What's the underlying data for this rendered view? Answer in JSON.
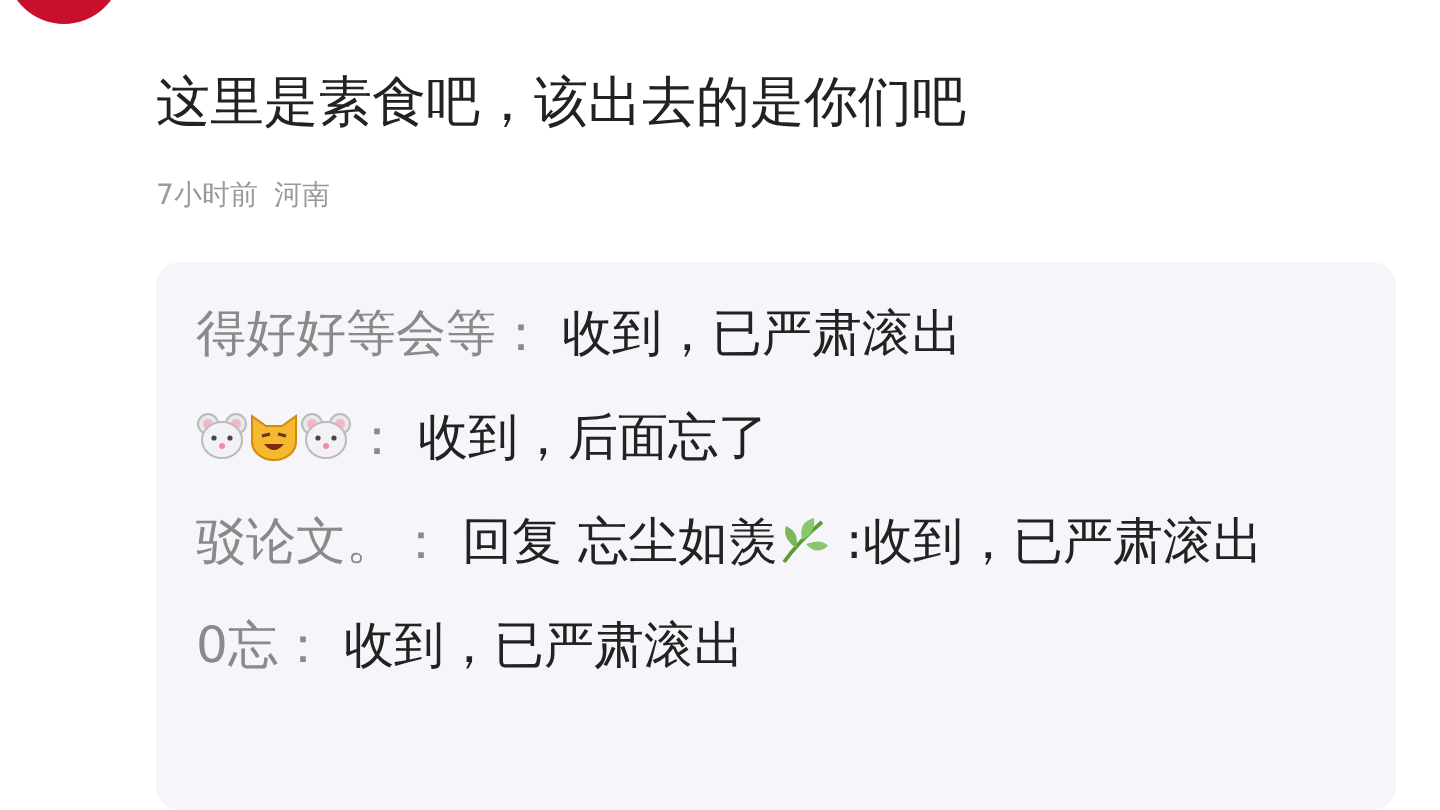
{
  "comment": {
    "text": "这里是素食吧，该出去的是你们吧",
    "time": "7小时前",
    "location": "河南"
  },
  "replies": [
    {
      "name": [
        {
          "kind": "text",
          "text": "得好好等会等："
        }
      ],
      "content": [
        {
          "kind": "text",
          "text": "收到，已严肃滚出"
        }
      ]
    },
    {
      "name": [
        {
          "kind": "mouse"
        },
        {
          "kind": "cat"
        },
        {
          "kind": "mouse"
        },
        {
          "kind": "text",
          "text": "："
        }
      ],
      "content": [
        {
          "kind": "text",
          "text": "收到，后面忘了"
        }
      ]
    },
    {
      "name": [
        {
          "kind": "text",
          "text": "驳论文。："
        }
      ],
      "content": [
        {
          "kind": "text",
          "text": "回复 忘尘如羡"
        },
        {
          "kind": "leaf"
        },
        {
          "kind": "text",
          "text": " :收到，已严肃滚出"
        }
      ]
    },
    {
      "name": [
        {
          "kind": "text",
          "text": "0忘："
        }
      ],
      "content": [
        {
          "kind": "text",
          "text": "收到，已严肃滚出"
        }
      ]
    }
  ]
}
